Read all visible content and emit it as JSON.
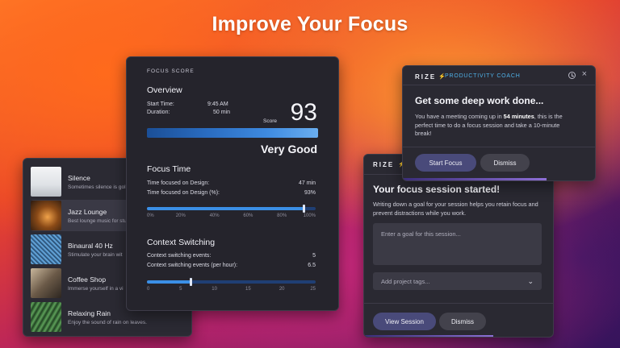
{
  "headline": "Improve Your Focus",
  "sounds": [
    {
      "title": "Silence",
      "desc": "Sometimes silence is gol",
      "thumb": "#e9ebee"
    },
    {
      "title": "Jazz Lounge",
      "desc": "Best lounge music for stu",
      "thumb": "#7a4a1e"
    },
    {
      "title": "Binaural 40 Hz",
      "desc": "Stimulate your brain wit",
      "thumb": "#2f5f8a"
    },
    {
      "title": "Coffee Shop",
      "desc": "Immerse yourself in a vi",
      "thumb": "#7f6f5a"
    },
    {
      "title": "Relaxing Rain",
      "desc": "Enjoy the sound of rain on leaves.",
      "thumb": "#3d7a3a"
    }
  ],
  "focus_score": {
    "section_label": "FOCUS SCORE",
    "overview_title": "Overview",
    "start_time_label": "Start Time:",
    "start_time_value": "9:45 AM",
    "duration_label": "Duration:",
    "duration_value": "50 min",
    "score_label": "Score",
    "score_value": "93",
    "rating": "Very Good",
    "focus_time_title": "Focus Time",
    "row1_label": "Time focused on Design:",
    "row1_value": "47 min",
    "row2_label": "Time focused on Design (%):",
    "row2_value": "93%",
    "focus_bar_percent": 93,
    "focus_ticks": [
      "0%",
      "20%",
      "40%",
      "60%",
      "80%",
      "100%"
    ],
    "context_title": "Context Switching",
    "row3_label": "Context switching events:",
    "row3_value": "5",
    "row4_label": "Context switching events (per hour):",
    "row4_value": "6.5",
    "context_bar_value": 6.5,
    "context_bar_max": 25,
    "context_ticks": [
      "0",
      "5",
      "10",
      "15",
      "20",
      "25"
    ]
  },
  "coach": {
    "brand": "RIZE",
    "badge": "PRODUCTIVITY COACH",
    "heading": "Get some deep work done...",
    "body_pre": "You have a meeting coming up in ",
    "body_bold": "54 minutes",
    "body_post": ", this is the perfect time to do a focus session and take a 10-minute break!",
    "start_label": "Start Focus",
    "dismiss_label": "Dismiss"
  },
  "session": {
    "brand": "RIZE",
    "heading": "Your focus session started!",
    "body": "Writing down a goal for your session helps you retain focus and prevent distractions while you work.",
    "goal_placeholder": "Enter a goal for this session...",
    "tags_placeholder": "Add project tags...",
    "view_label": "View Session",
    "dismiss_label": "Dismiss"
  },
  "colors": {
    "accent_blue": "#3b8fe6",
    "button_primary": "#494a7a",
    "badge_cyan": "#4fb1e8"
  }
}
